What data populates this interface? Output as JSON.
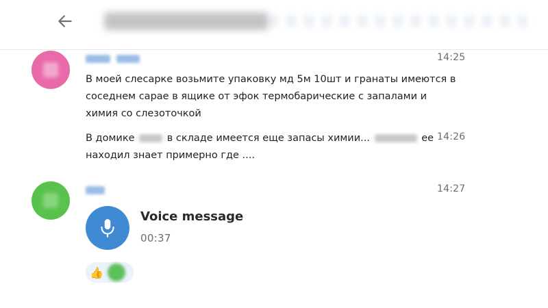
{
  "header": {
    "back_icon": "arrow-left-icon"
  },
  "messages": [
    {
      "avatar_color": "#e86aa8",
      "time_1": "14:25",
      "line_1": "В моей слесарке возьмите упаковку мд 5м 10шт и гранаты имеются в",
      "line_2": "соседнем сарае в ящике от эфок термобарические с запалами и",
      "line_3": "химия со слезоточкой",
      "time_2": "14:26",
      "line_4_a": "В домике",
      "line_4_b": "в складе имеется еще запасы химии...",
      "line_4_c": "ее",
      "line_5": "находил знает примерно где ...."
    },
    {
      "avatar_color": "#58c24c",
      "time": "14:27",
      "voice_title": "Voice message",
      "voice_duration": "00:37",
      "reaction_1": "👍"
    }
  ]
}
